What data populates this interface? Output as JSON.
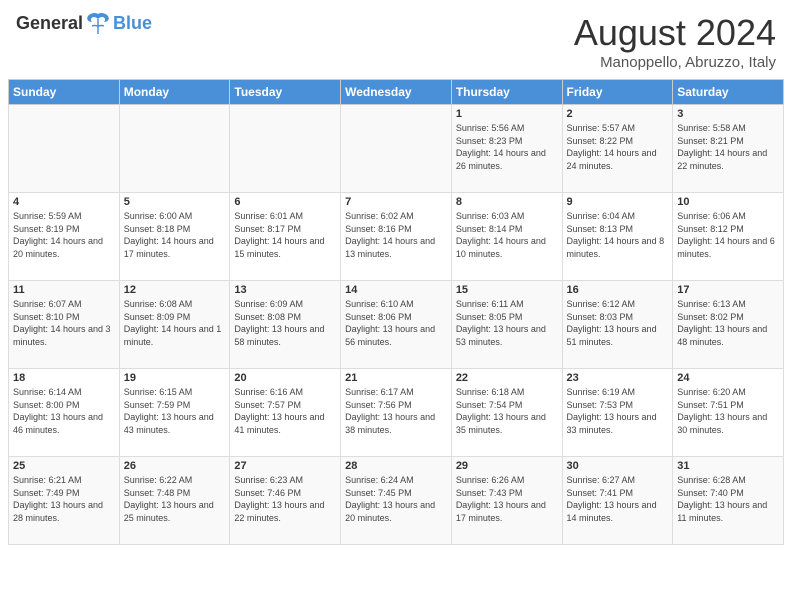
{
  "header": {
    "logo_text_general": "General",
    "logo_text_blue": "Blue",
    "month_year": "August 2024",
    "location": "Manoppello, Abruzzo, Italy"
  },
  "calendar": {
    "days_of_week": [
      "Sunday",
      "Monday",
      "Tuesday",
      "Wednesday",
      "Thursday",
      "Friday",
      "Saturday"
    ],
    "weeks": [
      [
        {
          "day": "",
          "empty": true
        },
        {
          "day": "",
          "empty": true
        },
        {
          "day": "",
          "empty": true
        },
        {
          "day": "",
          "empty": true
        },
        {
          "day": "1",
          "sunrise": "5:56 AM",
          "sunset": "8:23 PM",
          "daylight": "14 hours and 26 minutes."
        },
        {
          "day": "2",
          "sunrise": "5:57 AM",
          "sunset": "8:22 PM",
          "daylight": "14 hours and 24 minutes."
        },
        {
          "day": "3",
          "sunrise": "5:58 AM",
          "sunset": "8:21 PM",
          "daylight": "14 hours and 22 minutes."
        }
      ],
      [
        {
          "day": "4",
          "sunrise": "5:59 AM",
          "sunset": "8:19 PM",
          "daylight": "14 hours and 20 minutes."
        },
        {
          "day": "5",
          "sunrise": "6:00 AM",
          "sunset": "8:18 PM",
          "daylight": "14 hours and 17 minutes."
        },
        {
          "day": "6",
          "sunrise": "6:01 AM",
          "sunset": "8:17 PM",
          "daylight": "14 hours and 15 minutes."
        },
        {
          "day": "7",
          "sunrise": "6:02 AM",
          "sunset": "8:16 PM",
          "daylight": "14 hours and 13 minutes."
        },
        {
          "day": "8",
          "sunrise": "6:03 AM",
          "sunset": "8:14 PM",
          "daylight": "14 hours and 10 minutes."
        },
        {
          "day": "9",
          "sunrise": "6:04 AM",
          "sunset": "8:13 PM",
          "daylight": "14 hours and 8 minutes."
        },
        {
          "day": "10",
          "sunrise": "6:06 AM",
          "sunset": "8:12 PM",
          "daylight": "14 hours and 6 minutes."
        }
      ],
      [
        {
          "day": "11",
          "sunrise": "6:07 AM",
          "sunset": "8:10 PM",
          "daylight": "14 hours and 3 minutes."
        },
        {
          "day": "12",
          "sunrise": "6:08 AM",
          "sunset": "8:09 PM",
          "daylight": "14 hours and 1 minute."
        },
        {
          "day": "13",
          "sunrise": "6:09 AM",
          "sunset": "8:08 PM",
          "daylight": "13 hours and 58 minutes."
        },
        {
          "day": "14",
          "sunrise": "6:10 AM",
          "sunset": "8:06 PM",
          "daylight": "13 hours and 56 minutes."
        },
        {
          "day": "15",
          "sunrise": "6:11 AM",
          "sunset": "8:05 PM",
          "daylight": "13 hours and 53 minutes."
        },
        {
          "day": "16",
          "sunrise": "6:12 AM",
          "sunset": "8:03 PM",
          "daylight": "13 hours and 51 minutes."
        },
        {
          "day": "17",
          "sunrise": "6:13 AM",
          "sunset": "8:02 PM",
          "daylight": "13 hours and 48 minutes."
        }
      ],
      [
        {
          "day": "18",
          "sunrise": "6:14 AM",
          "sunset": "8:00 PM",
          "daylight": "13 hours and 46 minutes."
        },
        {
          "day": "19",
          "sunrise": "6:15 AM",
          "sunset": "7:59 PM",
          "daylight": "13 hours and 43 minutes."
        },
        {
          "day": "20",
          "sunrise": "6:16 AM",
          "sunset": "7:57 PM",
          "daylight": "13 hours and 41 minutes."
        },
        {
          "day": "21",
          "sunrise": "6:17 AM",
          "sunset": "7:56 PM",
          "daylight": "13 hours and 38 minutes."
        },
        {
          "day": "22",
          "sunrise": "6:18 AM",
          "sunset": "7:54 PM",
          "daylight": "13 hours and 35 minutes."
        },
        {
          "day": "23",
          "sunrise": "6:19 AM",
          "sunset": "7:53 PM",
          "daylight": "13 hours and 33 minutes."
        },
        {
          "day": "24",
          "sunrise": "6:20 AM",
          "sunset": "7:51 PM",
          "daylight": "13 hours and 30 minutes."
        }
      ],
      [
        {
          "day": "25",
          "sunrise": "6:21 AM",
          "sunset": "7:49 PM",
          "daylight": "13 hours and 28 minutes."
        },
        {
          "day": "26",
          "sunrise": "6:22 AM",
          "sunset": "7:48 PM",
          "daylight": "13 hours and 25 minutes."
        },
        {
          "day": "27",
          "sunrise": "6:23 AM",
          "sunset": "7:46 PM",
          "daylight": "13 hours and 22 minutes."
        },
        {
          "day": "28",
          "sunrise": "6:24 AM",
          "sunset": "7:45 PM",
          "daylight": "13 hours and 20 minutes."
        },
        {
          "day": "29",
          "sunrise": "6:26 AM",
          "sunset": "7:43 PM",
          "daylight": "13 hours and 17 minutes."
        },
        {
          "day": "30",
          "sunrise": "6:27 AM",
          "sunset": "7:41 PM",
          "daylight": "13 hours and 14 minutes."
        },
        {
          "day": "31",
          "sunrise": "6:28 AM",
          "sunset": "7:40 PM",
          "daylight": "13 hours and 11 minutes."
        }
      ]
    ]
  }
}
